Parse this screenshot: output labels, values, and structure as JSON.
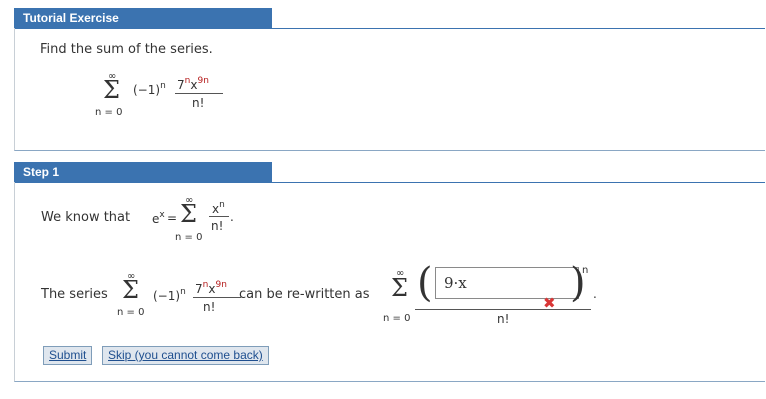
{
  "panel1": {
    "title": "Tutorial Exercise",
    "prompt": "Find the sum of the series.",
    "series": {
      "upper": "∞",
      "sigma": "Σ",
      "lower": "n = 0",
      "sign": "(−1)",
      "sign_exp": "n",
      "coef": "7",
      "coef_exp": "n",
      "var": "x",
      "var_exp": "9n",
      "denom": "n!"
    }
  },
  "panel2": {
    "title": "Step 1",
    "known_prefix": "We know that",
    "e": "e",
    "e_exp": "x",
    "equals": "=",
    "known_series": {
      "upper": "∞",
      "sigma": "Σ",
      "lower": "n = 0",
      "num": "x",
      "num_exp": "n",
      "denom": "n!",
      "period": "."
    },
    "rewrite_prefix": "The series",
    "rewrite_series": {
      "upper": "∞",
      "sigma": "Σ",
      "lower": "n = 0",
      "sign": "(−1)",
      "sign_exp": "n",
      "coef": "7",
      "coef_exp": "n",
      "var": "x",
      "var_exp": "9n",
      "denom": "n!"
    },
    "rewrite_middle": "can be re-written as",
    "target_series": {
      "upper": "∞",
      "sigma": "Σ",
      "lower": "n = 0",
      "lparen": "(",
      "rparen": ")",
      "exp": "n",
      "denom": "n!",
      "period": "."
    },
    "answer_value": "9·x",
    "answer_status": "incorrect",
    "incorrect_mark": "✖",
    "buttons": {
      "submit": "Submit",
      "skip": "Skip (you cannot come back)"
    },
    "colors": {
      "accent": "#3b73b0",
      "error": "#d93636",
      "highlight": "#b51c1c"
    }
  }
}
